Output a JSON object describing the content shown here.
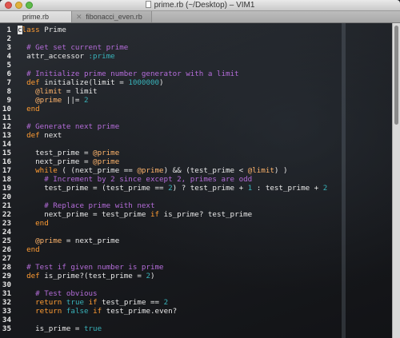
{
  "window": {
    "title": "prime.rb (~/Desktop) – VIM1",
    "tabs": [
      {
        "label": "prime.rb",
        "active": true
      },
      {
        "label": "fibonacci_even.rb",
        "active": false
      }
    ]
  },
  "editor": {
    "colors": {
      "keyword": "#ff9c33",
      "comment": "#b46cd9",
      "instance_var": "#ffb46b",
      "symbol_number": "#38b2b9",
      "plain": "#e8e8e8"
    },
    "scroll": {
      "visible_fraction": 0.32,
      "position_fraction": 0.0
    },
    "lines": [
      {
        "n": "1",
        "tokens": [
          {
            "t": "class",
            "c": "kw"
          },
          {
            "t": " Prime",
            "c": "pl"
          }
        ]
      },
      {
        "n": "2",
        "tokens": []
      },
      {
        "n": "3",
        "tokens": [
          {
            "t": "  # Get set current prime",
            "c": "cm"
          }
        ]
      },
      {
        "n": "4",
        "tokens": [
          {
            "t": "  attr_accessor ",
            "c": "pl"
          },
          {
            "t": ":prime",
            "c": "sym"
          }
        ]
      },
      {
        "n": "5",
        "tokens": []
      },
      {
        "n": "6",
        "tokens": [
          {
            "t": "  # Initialize prime number generator with a limit",
            "c": "cm"
          }
        ]
      },
      {
        "n": "7",
        "tokens": [
          {
            "t": "  def",
            "c": "kw"
          },
          {
            "t": " initialize(limit = ",
            "c": "pl"
          },
          {
            "t": "1000000",
            "c": "num"
          },
          {
            "t": ")",
            "c": "pl"
          }
        ]
      },
      {
        "n": "8",
        "tokens": [
          {
            "t": "    @limit",
            "c": "ivar"
          },
          {
            "t": " = limit",
            "c": "pl"
          }
        ]
      },
      {
        "n": "9",
        "tokens": [
          {
            "t": "    @prime",
            "c": "ivar"
          },
          {
            "t": " ||= ",
            "c": "pl"
          },
          {
            "t": "2",
            "c": "num"
          }
        ]
      },
      {
        "n": "10",
        "tokens": [
          {
            "t": "  end",
            "c": "kw"
          }
        ]
      },
      {
        "n": "11",
        "tokens": []
      },
      {
        "n": "12",
        "tokens": [
          {
            "t": "  # Generate next prime",
            "c": "cm"
          }
        ]
      },
      {
        "n": "13",
        "tokens": [
          {
            "t": "  def",
            "c": "kw"
          },
          {
            "t": " next",
            "c": "pl"
          }
        ]
      },
      {
        "n": "14",
        "tokens": []
      },
      {
        "n": "15",
        "tokens": [
          {
            "t": "    test_prime = ",
            "c": "pl"
          },
          {
            "t": "@prime",
            "c": "ivar"
          }
        ]
      },
      {
        "n": "16",
        "tokens": [
          {
            "t": "    next_prime = ",
            "c": "pl"
          },
          {
            "t": "@prime",
            "c": "ivar"
          }
        ]
      },
      {
        "n": "17",
        "tokens": [
          {
            "t": "    while",
            "c": "kw"
          },
          {
            "t": " ( (next_prime == ",
            "c": "pl"
          },
          {
            "t": "@prime",
            "c": "ivar"
          },
          {
            "t": ") && (test_prime < ",
            "c": "pl"
          },
          {
            "t": "@limit",
            "c": "ivar"
          },
          {
            "t": ") )",
            "c": "pl"
          }
        ]
      },
      {
        "n": "18",
        "tokens": [
          {
            "t": "      # Increment by 2 since except 2, primes are odd",
            "c": "cm"
          }
        ]
      },
      {
        "n": "19",
        "tokens": [
          {
            "t": "      test_prime = (test_prime == ",
            "c": "pl"
          },
          {
            "t": "2",
            "c": "num"
          },
          {
            "t": ") ? test_prime + ",
            "c": "pl"
          },
          {
            "t": "1",
            "c": "num"
          },
          {
            "t": " : test_prime + ",
            "c": "pl"
          },
          {
            "t": "2",
            "c": "num"
          }
        ]
      },
      {
        "n": "20",
        "tokens": []
      },
      {
        "n": "21",
        "tokens": [
          {
            "t": "      # Replace prime with next",
            "c": "cm"
          }
        ]
      },
      {
        "n": "22",
        "tokens": [
          {
            "t": "      next_prime = test_prime ",
            "c": "pl"
          },
          {
            "t": "if",
            "c": "kw"
          },
          {
            "t": " is_prime? test_prime",
            "c": "pl"
          }
        ]
      },
      {
        "n": "23",
        "tokens": [
          {
            "t": "    end",
            "c": "kw"
          }
        ]
      },
      {
        "n": "24",
        "tokens": []
      },
      {
        "n": "25",
        "tokens": [
          {
            "t": "    @prime",
            "c": "ivar"
          },
          {
            "t": " = next_prime",
            "c": "pl"
          }
        ]
      },
      {
        "n": "26",
        "tokens": [
          {
            "t": "  end",
            "c": "kw"
          }
        ]
      },
      {
        "n": "27",
        "tokens": []
      },
      {
        "n": "28",
        "tokens": [
          {
            "t": "  # Test if given number is prime",
            "c": "cm"
          }
        ]
      },
      {
        "n": "29",
        "tokens": [
          {
            "t": "  def",
            "c": "kw"
          },
          {
            "t": " is_prime?(test_prime = ",
            "c": "pl"
          },
          {
            "t": "2",
            "c": "num"
          },
          {
            "t": ")",
            "c": "pl"
          }
        ]
      },
      {
        "n": "30",
        "tokens": []
      },
      {
        "n": "31",
        "tokens": [
          {
            "t": "    # Test obvious",
            "c": "cm"
          }
        ]
      },
      {
        "n": "32",
        "tokens": [
          {
            "t": "    return",
            "c": "kw"
          },
          {
            "t": " ",
            "c": "pl"
          },
          {
            "t": "true",
            "c": "sym"
          },
          {
            "t": " ",
            "c": "pl"
          },
          {
            "t": "if",
            "c": "kw"
          },
          {
            "t": " test_prime == ",
            "c": "pl"
          },
          {
            "t": "2",
            "c": "num"
          }
        ]
      },
      {
        "n": "33",
        "tokens": [
          {
            "t": "    return",
            "c": "kw"
          },
          {
            "t": " ",
            "c": "pl"
          },
          {
            "t": "false",
            "c": "sym"
          },
          {
            "t": " ",
            "c": "pl"
          },
          {
            "t": "if",
            "c": "kw"
          },
          {
            "t": " test_prime.even?",
            "c": "pl"
          }
        ]
      },
      {
        "n": "34",
        "tokens": []
      },
      {
        "n": "35",
        "tokens": [
          {
            "t": "    is_prime = ",
            "c": "pl"
          },
          {
            "t": "true",
            "c": "sym"
          }
        ]
      }
    ]
  }
}
